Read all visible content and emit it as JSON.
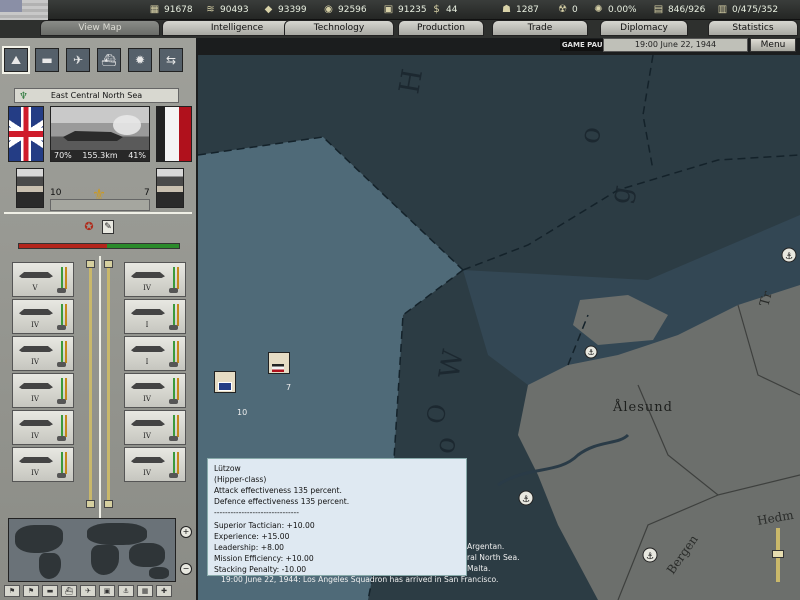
{
  "resources": [
    {
      "icon": "energy-icon",
      "glyph": "▦",
      "value": "91678"
    },
    {
      "icon": "metal-icon",
      "glyph": "≋",
      "value": "90493"
    },
    {
      "icon": "rare-materials-icon",
      "glyph": "◆",
      "value": "93399"
    },
    {
      "icon": "oil-icon",
      "glyph": "◉",
      "value": "92596"
    },
    {
      "icon": "supplies-icon",
      "glyph": "▣",
      "value": "91235"
    },
    {
      "icon": "money-icon",
      "glyph": "$",
      "value": "44"
    },
    {
      "icon": "manpower-icon",
      "glyph": "☗",
      "value": "1287"
    },
    {
      "icon": "nuclear-icon",
      "glyph": "☢",
      "value": "0"
    },
    {
      "icon": "dissent-icon",
      "glyph": "✺",
      "value": "0.00%"
    },
    {
      "icon": "transport-icon",
      "glyph": "▤",
      "value": "846/926"
    },
    {
      "icon": "convoy-icon",
      "glyph": "▥",
      "value": "0/475/352"
    }
  ],
  "tabs": [
    {
      "label": "View Map",
      "active": true
    },
    {
      "label": "Intelligence"
    },
    {
      "label": "Technology"
    },
    {
      "label": "Production"
    },
    {
      "label": "Trade"
    },
    {
      "label": "Diplomacy"
    },
    {
      "label": "Statistics"
    }
  ],
  "status": {
    "paused_label": "GAME PAUSED",
    "date": "19:00 June 22, 1944",
    "menu_label": "Menu"
  },
  "map_modes": [
    {
      "icon": "terrain-map-icon",
      "glyph": "⛰",
      "active": true
    },
    {
      "icon": "land-units-icon",
      "glyph": "▬"
    },
    {
      "icon": "air-units-icon",
      "glyph": "✈"
    },
    {
      "icon": "naval-units-icon",
      "glyph": "⛴"
    },
    {
      "icon": "combat-icon",
      "glyph": "✹"
    },
    {
      "icon": "logistics-icon",
      "glyph": "⇆"
    }
  ],
  "battle": {
    "region": "East Central North Sea",
    "attacker_pct": "70%",
    "distance": "155.3km",
    "defender_pct": "41%",
    "attacker_commander_skill": "10",
    "defender_commander_skill": "7",
    "attacker_strength": 0.55,
    "attacker_units": [
      {
        "level": "V"
      },
      {
        "level": "IV"
      },
      {
        "level": "IV"
      },
      {
        "level": "IV"
      },
      {
        "level": "IV"
      },
      {
        "level": "IV"
      }
    ],
    "defender_units": [
      {
        "level": "IV"
      },
      {
        "level": "I"
      },
      {
        "level": "I"
      },
      {
        "level": "IV"
      },
      {
        "level": "IV"
      },
      {
        "level": "IV"
      }
    ]
  },
  "map": {
    "city_label": "Ålesund",
    "region_label_1": "Tr",
    "region_label_2": "Bergen",
    "region_label_3": "Hedm",
    "sea_letters_1": "H",
    "sea_letters_2": "o",
    "sea_letters_3": "g",
    "sea_letters_4": "W",
    "sea_letters_5": "o",
    "sea_letters_6": "O",
    "stack_uk_count": "10",
    "stack_de_count": "7"
  },
  "tooltip": {
    "lines": [
      "Lützow",
      "(Hipper-class)",
      "Attack effectiveness 135 percent.",
      "Defence effectiveness 135 percent.",
      "-------------------------------",
      "Superior Tactician: +10.00",
      "Experience: +15.00",
      "Leadership: +8.00",
      "Mission Efficiency: +10.00",
      "Stacking Penalty: -10.00"
    ]
  },
  "log": {
    "fragment_1": "Argentan.",
    "fragment_2": "ral North Sea.",
    "fragment_3": "Malta.",
    "last_line": "19:00 June 22, 1944: Los Angeles Squadron has arrived in San Francisco."
  }
}
